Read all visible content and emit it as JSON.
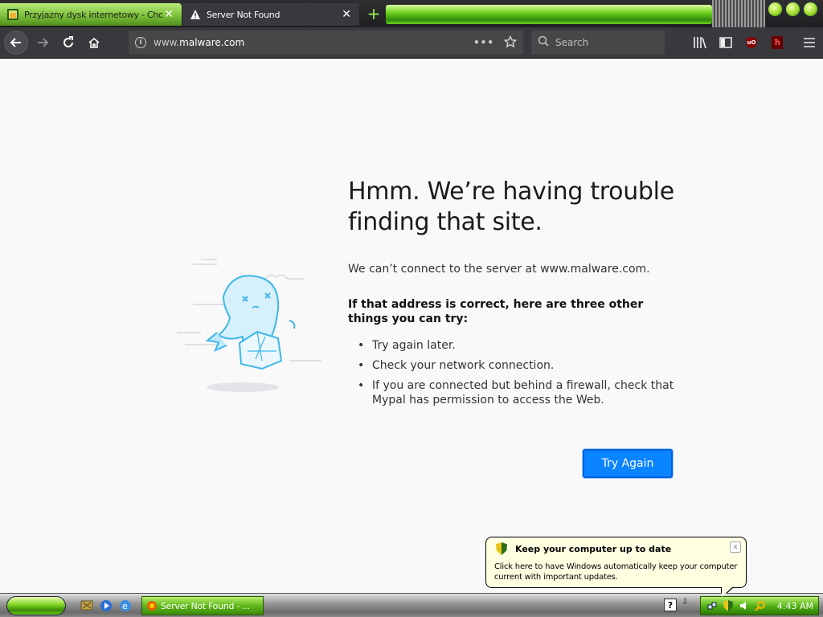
{
  "browser": {
    "tabs": [
      {
        "label": "Przyjazny dysk internetowy - Cho",
        "active": false,
        "icon": "folder-favicon"
      },
      {
        "label": "Server Not Found",
        "active": true,
        "icon": "warning-triangle-icon"
      }
    ],
    "address_bar": {
      "prefix": "www.",
      "domain": "malware.com"
    },
    "search": {
      "placeholder": "Search"
    },
    "accent_color": "#7ed420"
  },
  "error_page": {
    "title": "Hmm. We’re having trouble finding that site.",
    "description": "We can’t connect to the server at www.malware.com.",
    "subtitle": "If that address is correct, here are three other things you can try:",
    "suggestions": [
      "Try again later.",
      "Check your network connection.",
      "If you are connected but behind a firewall, check that Mypal has permission to access the Web."
    ],
    "button_label": "Try Again",
    "button_color": "#0a84ff"
  },
  "balloon": {
    "title": "Keep your computer up to date",
    "text": "Click here to have Windows automatically keep your computer current with important updates.",
    "close_glyph": "x"
  },
  "taskbar": {
    "task_button_label": "Server Not Found - ...",
    "clock": "4:43 AM",
    "help_glyph": "?"
  }
}
